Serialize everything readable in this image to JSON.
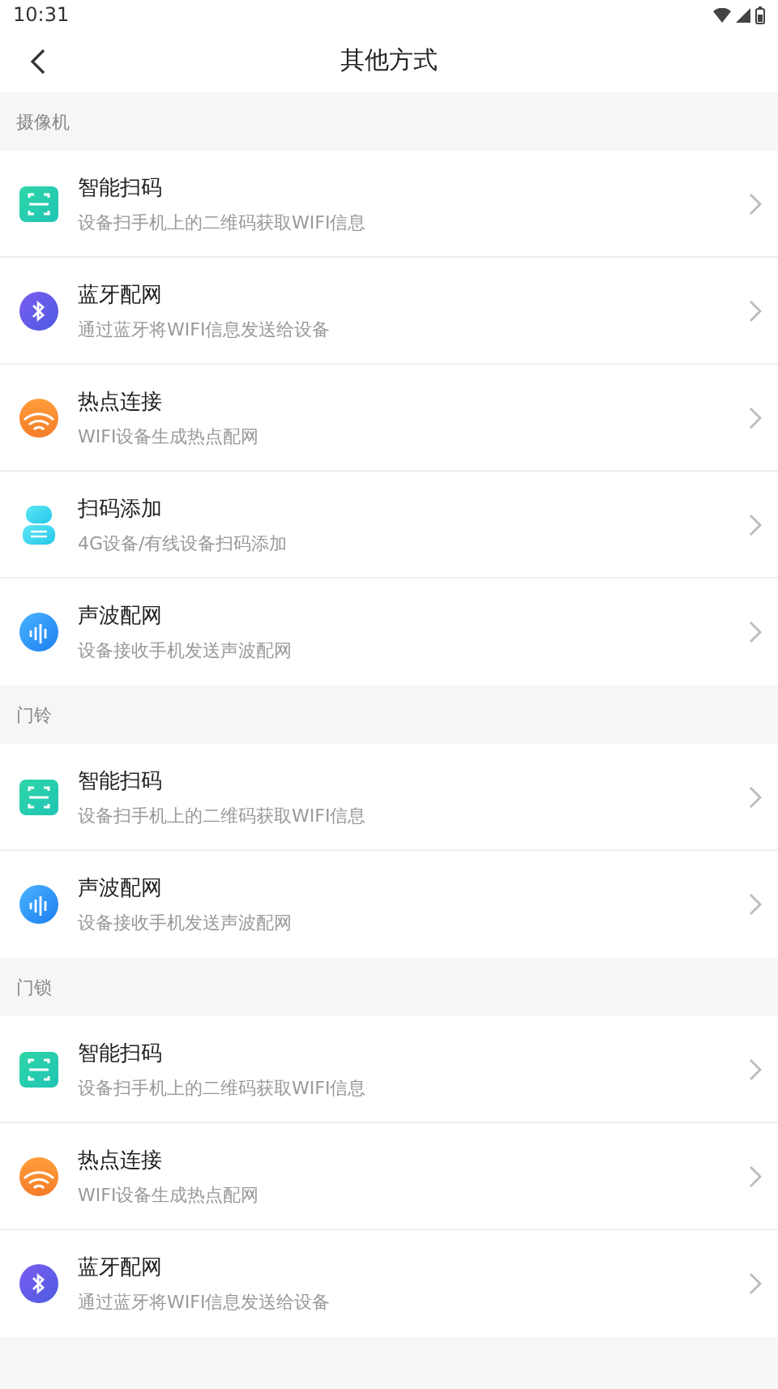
{
  "status_bar": {
    "time": "10:31"
  },
  "header": {
    "title": "其他方式"
  },
  "sections": [
    {
      "title": "摄像机",
      "items": [
        {
          "kind": "qr",
          "title": "智能扫码",
          "subtitle": "设备扫手机上的二维码获取WIFI信息"
        },
        {
          "kind": "bluetooth",
          "title": "蓝牙配网",
          "subtitle": "通过蓝牙将WIFI信息发送给设备"
        },
        {
          "kind": "hotspot",
          "title": "热点连接",
          "subtitle": "WIFI设备生成热点配网"
        },
        {
          "kind": "scan",
          "title": "扫码添加",
          "subtitle": "4G设备/有线设备扫码添加"
        },
        {
          "kind": "sound",
          "title": "声波配网",
          "subtitle": "设备接收手机发送声波配网"
        }
      ]
    },
    {
      "title": "门铃",
      "items": [
        {
          "kind": "qr",
          "title": "智能扫码",
          "subtitle": "设备扫手机上的二维码获取WIFI信息"
        },
        {
          "kind": "sound",
          "title": "声波配网",
          "subtitle": "设备接收手机发送声波配网"
        }
      ]
    },
    {
      "title": "门锁",
      "items": [
        {
          "kind": "qr",
          "title": "智能扫码",
          "subtitle": "设备扫手机上的二维码获取WIFI信息"
        },
        {
          "kind": "hotspot",
          "title": "热点连接",
          "subtitle": "WIFI设备生成热点配网"
        },
        {
          "kind": "bluetooth",
          "title": "蓝牙配网",
          "subtitle": "通过蓝牙将WIFI信息发送给设备"
        }
      ]
    }
  ]
}
